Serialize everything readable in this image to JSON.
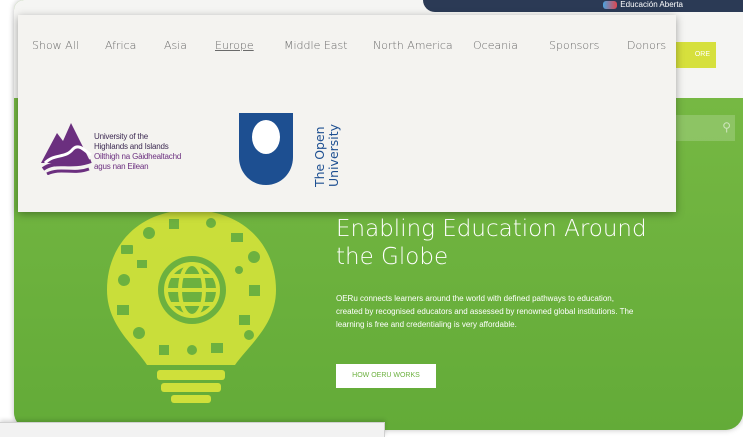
{
  "background_site": {
    "brand_name": "Educación Aberta",
    "more_button_label": "ORE",
    "search_icon": "search-icon",
    "hero_title": "Enabling Education Around the Globe",
    "hero_text": "OERu connects learners around the world with defined pathways to education, created by recognised educators and assessed by renowned global institutions. The learning is free and credentialing is very affordable.",
    "hero_button_label": "HOW OERU WORKS",
    "hero_illustration": "lightbulb-icons-illustration",
    "colors": {
      "green": "#6cb13f",
      "lime_button": "#d6e03d",
      "navy": "#2b3a55"
    }
  },
  "filter": {
    "tabs": [
      {
        "label": "Show All",
        "active": false
      },
      {
        "label": "Africa",
        "active": false
      },
      {
        "label": "Asia",
        "active": false
      },
      {
        "label": "Europe",
        "active": true
      },
      {
        "label": "Middle East",
        "active": false
      },
      {
        "label": "North America",
        "active": false
      },
      {
        "label": "Oceania",
        "active": false
      },
      {
        "label": "Sponsors",
        "active": false
      },
      {
        "label": "Donors",
        "active": false
      }
    ]
  },
  "logos": {
    "uhi": {
      "line1": "University of the",
      "line2": "Highlands and Islands",
      "line3": "Oilthigh na Gàidhealtachd",
      "line4": "agus nan Eilean",
      "colors": {
        "dark": "#3d2a52",
        "purple": "#6b2f7f"
      }
    },
    "open_university": {
      "line1": "The Open",
      "line2": "University",
      "color": "#1d4f91"
    }
  }
}
